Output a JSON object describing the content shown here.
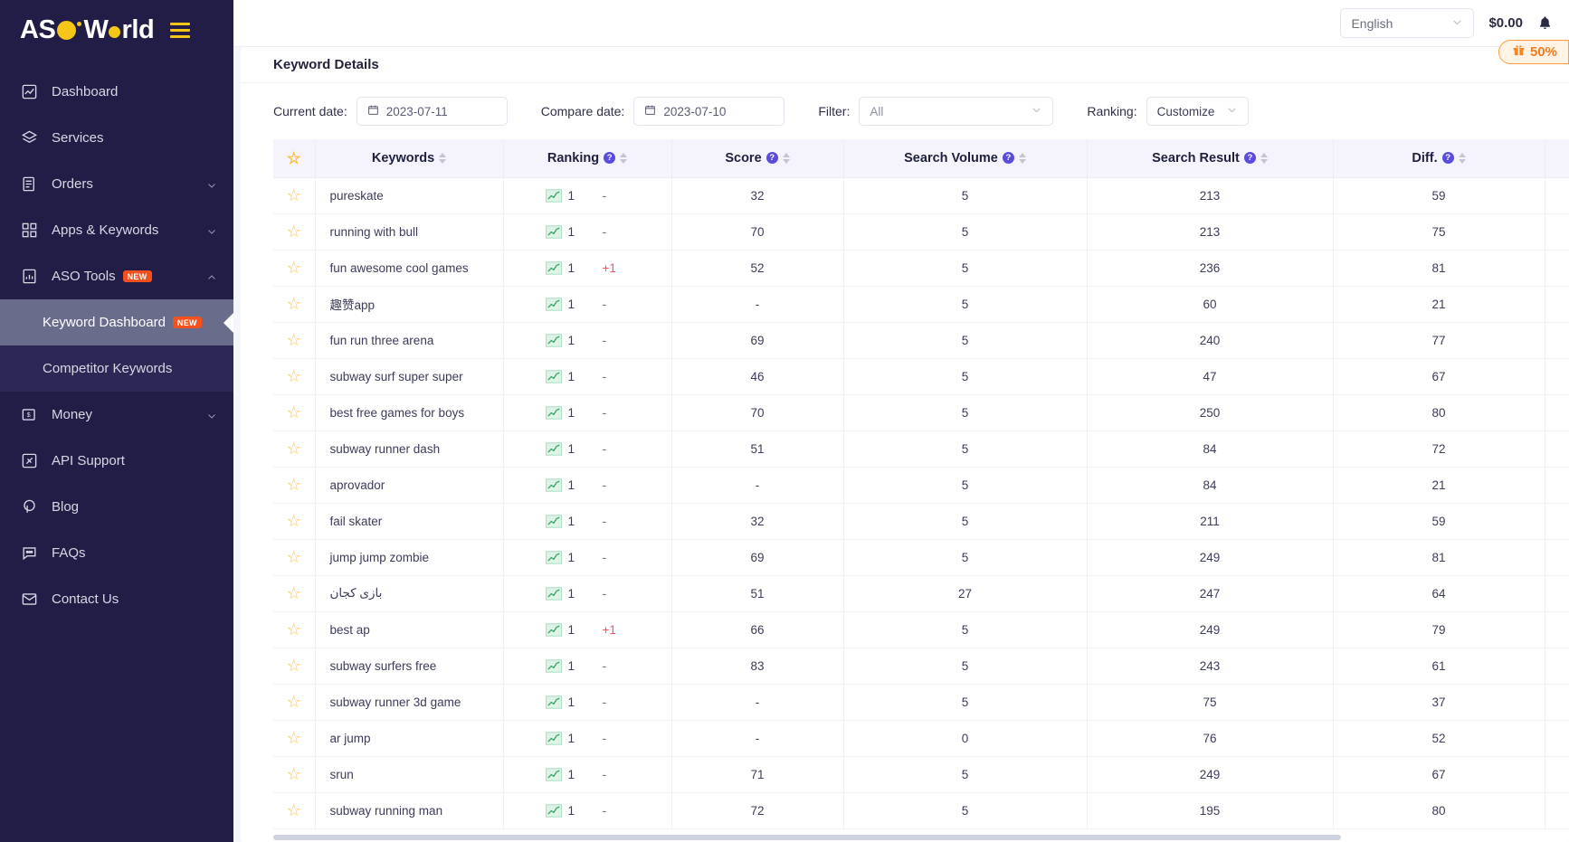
{
  "brand": {
    "name_part1": "AS",
    "name_part2": "World",
    "menu_icon": "hamburger-icon"
  },
  "sidebar": {
    "items": [
      {
        "label": "Dashboard",
        "icon": "dashboard-chart-icon",
        "expandable": false,
        "badge": ""
      },
      {
        "label": "Services",
        "icon": "layers-icon",
        "expandable": false,
        "badge": ""
      },
      {
        "label": "Orders",
        "icon": "document-list-icon",
        "expandable": true,
        "badge": ""
      },
      {
        "label": "Apps & Keywords",
        "icon": "grid-apps-icon",
        "expandable": true,
        "badge": ""
      },
      {
        "label": "ASO Tools",
        "icon": "bar-chart-report-icon",
        "expandable": true,
        "badge": "NEW"
      }
    ],
    "sub_items": [
      {
        "label": "Keyword Dashboard",
        "badge": "NEW",
        "active": true
      },
      {
        "label": "Competitor Keywords",
        "badge": "",
        "active": false
      }
    ],
    "items_bottom": [
      {
        "label": "Money",
        "icon": "money-bill-icon",
        "expandable": true,
        "badge": ""
      },
      {
        "label": "API Support",
        "icon": "api-plug-icon",
        "expandable": false,
        "badge": ""
      },
      {
        "label": "Blog",
        "icon": "pen-circle-icon",
        "expandable": false,
        "badge": ""
      },
      {
        "label": "FAQs",
        "icon": "chat-dots-icon",
        "expandable": false,
        "badge": ""
      },
      {
        "label": "Contact Us",
        "icon": "envelope-icon",
        "expandable": false,
        "badge": ""
      }
    ]
  },
  "topbar": {
    "language": "English",
    "balance": "$0.00",
    "bell_icon": "bell-icon",
    "promo_label": "50%",
    "promo_icon": "gift-icon"
  },
  "page": {
    "title": "Keyword Details"
  },
  "filters": {
    "current_date_label": "Current date:",
    "current_date_value": "2023-07-11",
    "compare_date_label": "Compare date:",
    "compare_date_value": "2023-07-10",
    "filter_label": "Filter:",
    "filter_value": "All",
    "ranking_label": "Ranking:",
    "ranking_value": "Customize"
  },
  "table": {
    "columns": [
      {
        "key": "star",
        "label": ""
      },
      {
        "key": "kw",
        "label": "Keywords",
        "help": false,
        "sortable": true
      },
      {
        "key": "rank",
        "label": "Ranking",
        "help": true,
        "sortable": true
      },
      {
        "key": "score",
        "label": "Score",
        "help": true,
        "sortable": true
      },
      {
        "key": "vol",
        "label": "Search Volume",
        "help": true,
        "sortable": true
      },
      {
        "key": "res",
        "label": "Search Result",
        "help": true,
        "sortable": true
      },
      {
        "key": "diff",
        "label": "Diff.",
        "help": true,
        "sortable": true
      },
      {
        "key": "last",
        "label": ""
      }
    ],
    "rows": [
      {
        "keyword": "pureskate",
        "rank": "1",
        "rank_diff": "-",
        "score": "32",
        "volume": "5",
        "result": "213",
        "diff": "59"
      },
      {
        "keyword": "running with bull",
        "rank": "1",
        "rank_diff": "-",
        "score": "70",
        "volume": "5",
        "result": "213",
        "diff": "75"
      },
      {
        "keyword": "fun awesome cool games",
        "rank": "1",
        "rank_diff": "+1",
        "score": "52",
        "volume": "5",
        "result": "236",
        "diff": "81"
      },
      {
        "keyword": "趣赞app",
        "rank": "1",
        "rank_diff": "-",
        "score": "-",
        "volume": "5",
        "result": "60",
        "diff": "21"
      },
      {
        "keyword": "fun run three arena",
        "rank": "1",
        "rank_diff": "-",
        "score": "69",
        "volume": "5",
        "result": "240",
        "diff": "77"
      },
      {
        "keyword": "subway surf super super",
        "rank": "1",
        "rank_diff": "-",
        "score": "46",
        "volume": "5",
        "result": "47",
        "diff": "67"
      },
      {
        "keyword": "best free games for boys",
        "rank": "1",
        "rank_diff": "-",
        "score": "70",
        "volume": "5",
        "result": "250",
        "diff": "80"
      },
      {
        "keyword": "subway runner dash",
        "rank": "1",
        "rank_diff": "-",
        "score": "51",
        "volume": "5",
        "result": "84",
        "diff": "72"
      },
      {
        "keyword": "aprovador",
        "rank": "1",
        "rank_diff": "-",
        "score": "-",
        "volume": "5",
        "result": "84",
        "diff": "21"
      },
      {
        "keyword": "fail skater",
        "rank": "1",
        "rank_diff": "-",
        "score": "32",
        "volume": "5",
        "result": "211",
        "diff": "59"
      },
      {
        "keyword": "jump jump zombie",
        "rank": "1",
        "rank_diff": "-",
        "score": "69",
        "volume": "5",
        "result": "249",
        "diff": "81"
      },
      {
        "keyword": "بازی کجان",
        "rank": "1",
        "rank_diff": "-",
        "score": "51",
        "volume": "27",
        "result": "247",
        "diff": "64"
      },
      {
        "keyword": "best ap",
        "rank": "1",
        "rank_diff": "+1",
        "score": "66",
        "volume": "5",
        "result": "249",
        "diff": "79"
      },
      {
        "keyword": "subway surfers free",
        "rank": "1",
        "rank_diff": "-",
        "score": "83",
        "volume": "5",
        "result": "243",
        "diff": "61"
      },
      {
        "keyword": "subway runner 3d game",
        "rank": "1",
        "rank_diff": "-",
        "score": "-",
        "volume": "5",
        "result": "75",
        "diff": "37"
      },
      {
        "keyword": "ar jump",
        "rank": "1",
        "rank_diff": "-",
        "score": "-",
        "volume": "0",
        "result": "76",
        "diff": "52"
      },
      {
        "keyword": "srun",
        "rank": "1",
        "rank_diff": "-",
        "score": "71",
        "volume": "5",
        "result": "249",
        "diff": "67"
      },
      {
        "keyword": "subway running man",
        "rank": "1",
        "rank_diff": "-",
        "score": "72",
        "volume": "5",
        "result": "195",
        "diff": "80"
      }
    ]
  },
  "colors": {
    "sidebar_bg": "#221d46",
    "accent_yellow": "#f5c518",
    "badge_red": "#f4511e",
    "help_purple": "#5b4ce0",
    "promo_orange": "#f07c1e",
    "diff_up_red": "#f4526a",
    "star_gold": "#fcbf2e"
  }
}
